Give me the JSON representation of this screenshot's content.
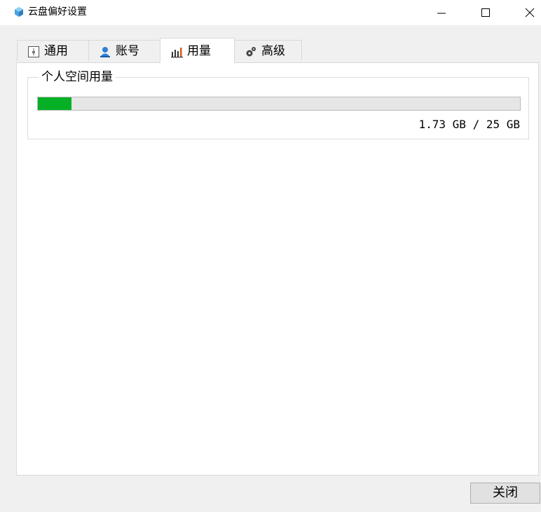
{
  "window": {
    "title": "云盘偏好设置"
  },
  "tabs": [
    {
      "label": "通用",
      "icon": "general-icon"
    },
    {
      "label": "账号",
      "icon": "user-icon"
    },
    {
      "label": "用量",
      "icon": "bar-chart-icon",
      "selected": true
    },
    {
      "label": "高级",
      "icon": "gears-icon"
    }
  ],
  "usage": {
    "group_title": "个人空间用量",
    "progress_percent": 6.92,
    "text": "1.73 GB / 25 GB",
    "bar_color": "#06b025"
  },
  "footer": {
    "close_label": "关闭"
  }
}
